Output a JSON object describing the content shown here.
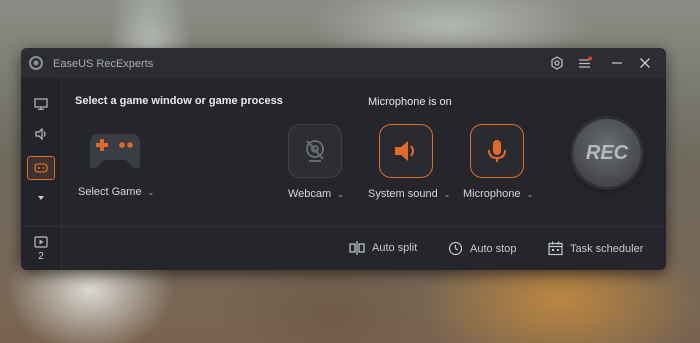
{
  "window": {
    "app_title": "EaseUS RecExperts",
    "settings_icon": "gear-icon",
    "menu_icon": "menu-icon",
    "notification_color": "#e6401f",
    "accent_color": "#e26a28"
  },
  "sidebar": {
    "items": [
      {
        "name": "screen-mode",
        "icon": "monitor-icon"
      },
      {
        "name": "audio-mode",
        "icon": "speaker-icon"
      },
      {
        "name": "game-mode",
        "icon": "gamepad-icon",
        "active": true
      },
      {
        "name": "more",
        "icon": "caret-down-icon"
      }
    ],
    "recordings_count": "2"
  },
  "game": {
    "heading": "Select a game window or game process",
    "select_label": "Select Game"
  },
  "audio": {
    "heading": "Microphone is on",
    "webcam_label": "Webcam",
    "system_sound_label": "System sound",
    "microphone_label": "Microphone"
  },
  "rec_button": {
    "label": "REC"
  },
  "bottom": {
    "auto_split": "Auto split",
    "auto_stop": "Auto stop",
    "task_scheduler": "Task scheduler"
  }
}
